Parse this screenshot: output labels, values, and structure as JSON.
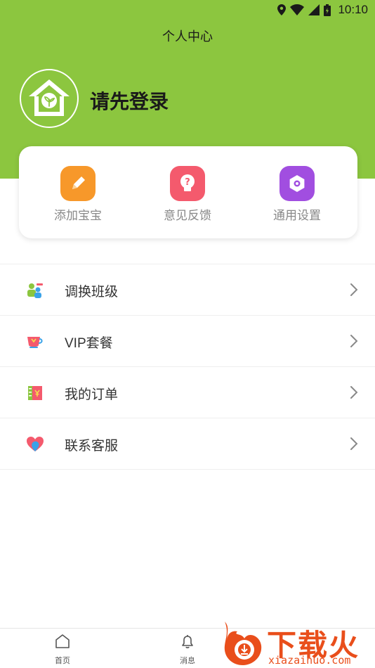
{
  "status_bar": {
    "time": "10:10"
  },
  "header": {
    "title": "个人中心",
    "login_prompt": "请先登录"
  },
  "quick_actions": [
    {
      "label": "添加宝宝",
      "icon": "pencil-icon",
      "color": "#f7982a"
    },
    {
      "label": "意见反馈",
      "icon": "lightbulb-icon",
      "color": "#f45a6d"
    },
    {
      "label": "通用设置",
      "icon": "hexagon-settings-icon",
      "color": "#a14ee0"
    }
  ],
  "menu": [
    {
      "label": "调换班级",
      "icon": "switch-class-icon"
    },
    {
      "label": "VIP套餐",
      "icon": "vip-cup-icon"
    },
    {
      "label": "我的订单",
      "icon": "order-ticket-icon"
    },
    {
      "label": "联系客服",
      "icon": "customer-service-heart-icon"
    }
  ],
  "tabbar": [
    {
      "label": "首页",
      "icon": "home-icon"
    },
    {
      "label": "消息",
      "icon": "bell-icon"
    }
  ],
  "watermark": {
    "text": "下载火",
    "sub": "xiazaihuo.com"
  },
  "colors": {
    "primary": "#8cc63f",
    "watermark": "#e94e1b"
  }
}
